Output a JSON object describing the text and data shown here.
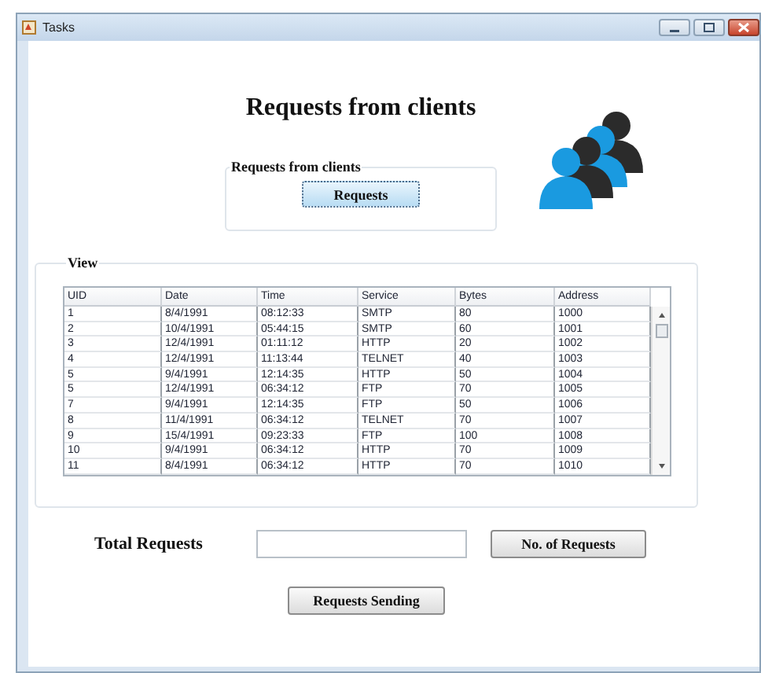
{
  "window": {
    "title": "Tasks"
  },
  "heading": "Requests from clients",
  "request_group": {
    "legend": "Requests from clients",
    "button": "Requests"
  },
  "view": {
    "legend": "View",
    "table": {
      "columns": [
        "UID",
        "Date",
        "Time",
        "Service",
        "Bytes",
        "Address"
      ],
      "rows": [
        [
          "1",
          "8/4/1991",
          "08:12:33",
          "SMTP",
          "80",
          "1000"
        ],
        [
          "2",
          "10/4/1991",
          "05:44:15",
          "SMTP",
          "60",
          "1001"
        ],
        [
          "3",
          "12/4/1991",
          "01:11:12",
          "HTTP",
          "20",
          "1002"
        ],
        [
          "4",
          "12/4/1991",
          "11:13:44",
          "TELNET",
          "40",
          "1003"
        ],
        [
          "5",
          "9/4/1991",
          "12:14:35",
          "HTTP",
          "50",
          "1004"
        ],
        [
          "5",
          "12/4/1991",
          "06:34:12",
          "FTP",
          "70",
          "1005"
        ],
        [
          "7",
          "9/4/1991",
          "12:14:35",
          "FTP",
          "50",
          "1006"
        ],
        [
          "8",
          "11/4/1991",
          "06:34:12",
          "TELNET",
          "70",
          "1007"
        ],
        [
          "9",
          "15/4/1991",
          "09:23:33",
          "FTP",
          "100",
          "1008"
        ],
        [
          "10",
          "9/4/1991",
          "06:34:12",
          "HTTP",
          "70",
          "1009"
        ],
        [
          "11",
          "8/4/1991",
          "06:34:12",
          "HTTP",
          "70",
          "1010"
        ]
      ]
    }
  },
  "total": {
    "label": "Total Requests",
    "button": "No. of Requests"
  },
  "send_button": "Requests Sending"
}
